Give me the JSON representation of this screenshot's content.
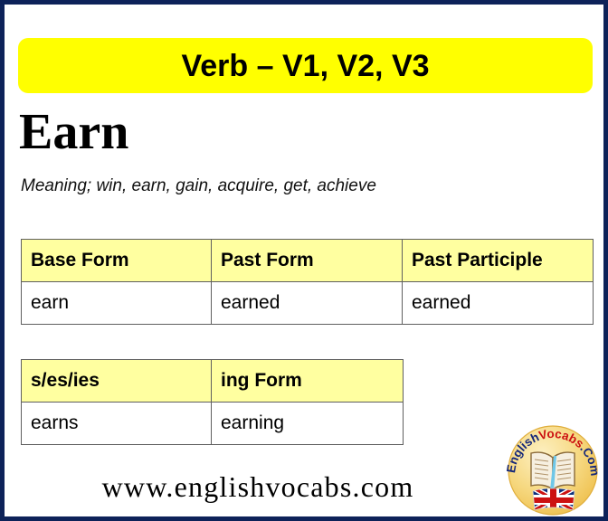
{
  "page": {
    "border_color": "#0d2259",
    "background": "#ffffff"
  },
  "banner": {
    "text": "Verb – V1, V2, V3",
    "background": "#ffff00",
    "text_color": "#000000"
  },
  "word": {
    "headword": "Earn",
    "meaning": "Meaning; win, earn, gain, acquire, get, achieve"
  },
  "tables": {
    "forms": {
      "headers": [
        "Base Form",
        "Past Form",
        "Past Participle"
      ],
      "row": [
        "earn",
        "earned",
        "earned"
      ],
      "header_background": "#ffffa0",
      "border_color": "#5f5f5f"
    },
    "inflections": {
      "headers": [
        "s/es/ies",
        "ing Form"
      ],
      "row": [
        "earns",
        "earning"
      ],
      "header_background": "#ffffa0",
      "border_color": "#5f5f5f"
    }
  },
  "footer": {
    "site_url": "www.englishvocabs.com"
  },
  "logo": {
    "brand_part1": "English",
    "brand_part2": "Vocabs",
    "brand_part3": ".Com",
    "part1_color": "#16287a",
    "part2_color": "#cc1111",
    "part3_color": "#16287a",
    "badge_color": "#f2c960",
    "icons": [
      "open-book-icon",
      "uk-flag-icon"
    ]
  }
}
